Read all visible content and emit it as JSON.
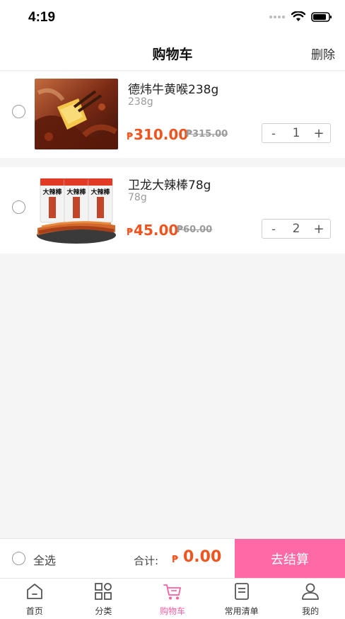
{
  "status_bar": {
    "time": "4:19"
  },
  "nav": {
    "title": "购物车",
    "delete_label": "删除"
  },
  "items": [
    {
      "name": "德炜牛黄喉238g",
      "spec": "238g",
      "currency": "₱",
      "price": "310.00",
      "original_price": "₱315.00",
      "quantity": "1",
      "minus": "-",
      "plus": "+"
    },
    {
      "name": "卫龙大辣棒78g",
      "spec": "78g",
      "currency": "₱",
      "price": "45.00",
      "original_price": "₱60.00",
      "quantity": "2",
      "minus": "-",
      "plus": "+"
    }
  ],
  "package_text": [
    "大辣棒",
    "大辣棒",
    "大辣棒"
  ],
  "footer": {
    "select_all_label": "全选",
    "total_label": "合计:",
    "total_currency": "₱",
    "total_value": "0.00",
    "checkout_label": "去结算"
  },
  "tabs": [
    {
      "label": "首页",
      "icon": "home-icon"
    },
    {
      "label": "分类",
      "icon": "category-icon"
    },
    {
      "label": "购物车",
      "icon": "cart-icon",
      "active": true
    },
    {
      "label": "常用清单",
      "icon": "list-icon"
    },
    {
      "label": "我的",
      "icon": "profile-icon"
    }
  ],
  "colors": {
    "accent": "#ff5ea0",
    "checkout": "#ff6aa6",
    "price": "#f0541e"
  }
}
